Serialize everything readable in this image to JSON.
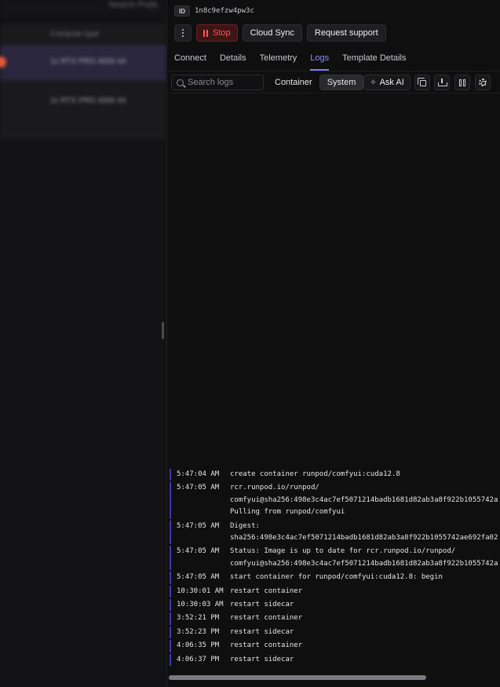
{
  "background": {
    "search_text": "Search Pods",
    "column_header": "Compute type",
    "rows": [
      "1x RTX PRO 4000 44",
      "1x RTX PRO 4000 44"
    ]
  },
  "drawer": {
    "id_badge": "ID",
    "pod_id": "1n8c9efzw4pw3c",
    "actions": {
      "stop": "Stop",
      "cloud_sync": "Cloud Sync",
      "request_support": "Request support"
    },
    "tabs": [
      "Connect",
      "Details",
      "Telemetry",
      "Logs",
      "Template Details"
    ],
    "active_tab": "Logs",
    "toolbar": {
      "search_placeholder": "Search logs",
      "segments": [
        "Container",
        "System"
      ],
      "selected_segment": "System",
      "ask_ai": "Ask AI"
    },
    "logs": [
      {
        "time": "5:47:04 AM",
        "lines": [
          "create container runpod/comfyui:cuda12.8"
        ]
      },
      {
        "time": "5:47:05 AM",
        "lines": [
          "rcr.runpod.io/runpod/",
          "comfyui@sha256:498e3c4ac7ef5071214badb1681d82ab3a8f922b1055742a",
          "Pulling from runpod/comfyui"
        ]
      },
      {
        "time": "5:47:05 AM",
        "lines": [
          "Digest:",
          "sha256:498e3c4ac7ef5071214badb1681d82ab3a8f922b1055742ae692fa02"
        ]
      },
      {
        "time": "5:47:05 AM",
        "lines": [
          "Status: Image is up to date for rcr.runpod.io/runpod/",
          "comfyui@sha256:498e3c4ac7ef5071214badb1681d82ab3a8f922b1055742a"
        ]
      },
      {
        "time": "5:47:05 AM",
        "lines": [
          "start container for runpod/comfyui:cuda12.8: begin"
        ]
      },
      {
        "time": "10:30:01 AM",
        "lines": [
          "restart container"
        ]
      },
      {
        "time": "10:30:03 AM",
        "lines": [
          "restart sidecar"
        ]
      },
      {
        "time": "3:52:21 PM",
        "lines": [
          "restart container"
        ]
      },
      {
        "time": "3:52:23 PM",
        "lines": [
          "restart sidecar"
        ]
      },
      {
        "time": "4:06:35 PM",
        "lines": [
          "restart container"
        ]
      },
      {
        "time": "4:06:37 PM",
        "lines": [
          "restart sidecar"
        ]
      }
    ]
  }
}
